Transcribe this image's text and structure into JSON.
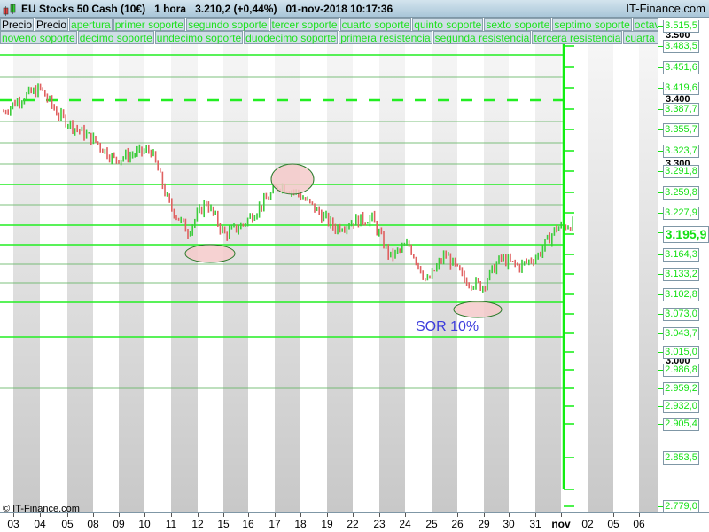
{
  "header": {
    "title": "EU Stocks 50 Cash (10€)   1 hora   3.210,2 (+0,44%)   01-nov-2018 10:17:36",
    "brand": "IT-Finance.com",
    "logo_icon": "candlestick-logo-icon"
  },
  "legend_row1": [
    "Precio",
    "Precio",
    "apertura",
    "primer soporte",
    "segundo soporte",
    "tercer soporte",
    "cuarto soporte",
    "quinto soporte",
    "sexto soporte",
    "septimo soporte",
    "octavo soporte"
  ],
  "legend_row2": [
    "noveno soporte",
    "decimo soporte",
    "undecimo soporte",
    "duodecimo soporte",
    "primera resistencia",
    "segunda resistencia",
    "tercera resistencia",
    "cuarta resistencia"
  ],
  "annotation": "SOR 10%",
  "copyright": "© IT-Finance.com",
  "colors": {
    "up": "#3ccc3c",
    "down": "#e06060",
    "level": "#00ee00",
    "ellipse_fill": "#f4caca",
    "ellipse_stroke": "#2a7a2a"
  },
  "chart_data": {
    "type": "candlestick",
    "x_labels": [
      "03",
      "04",
      "05",
      "08",
      "09",
      "10",
      "11",
      "12",
      "15",
      "16",
      "17",
      "18",
      "19",
      "22",
      "23",
      "24",
      "25",
      "26",
      "29",
      "30",
      "31",
      "nov",
      "02",
      "05",
      "06"
    ],
    "price_labels": [
      "3.515,5",
      "3.483,5",
      "3.451,6",
      "3.419,6",
      "3.387,7",
      "3.355,7",
      "3.323,7",
      "3.291,8",
      "3.259,8",
      "3.227,9",
      "3.195,9",
      "3.164,3",
      "3.133,2",
      "3.102,8",
      "3.073,0",
      "3.043,7",
      "3.015,0",
      "2.986,8",
      "2.959,2",
      "2.932,0",
      "2.905,4",
      "2.853,5",
      "2.779,0"
    ],
    "round_labels": [
      "3.500",
      "3.400",
      "3.300",
      "3.000"
    ],
    "last_price": "3.195,9",
    "levels": [
      3483.5,
      3451.6,
      3419.6,
      3387.7,
      3355.7,
      3323.7,
      3291.8,
      3259.8,
      3227.9,
      3195.9,
      3164.3,
      3133.2,
      3102.8,
      3043.7,
      2959.2
    ],
    "price_path": [
      3384,
      3405,
      3418,
      3378,
      3356,
      3338,
      3310,
      3318,
      3325,
      3240,
      3200,
      3245,
      3195,
      3210,
      3240,
      3272,
      3258,
      3232,
      3205,
      3215,
      3220,
      3160,
      3180,
      3120,
      3165,
      3125,
      3115,
      3158,
      3145,
      3162,
      3205,
      3212
    ]
  }
}
